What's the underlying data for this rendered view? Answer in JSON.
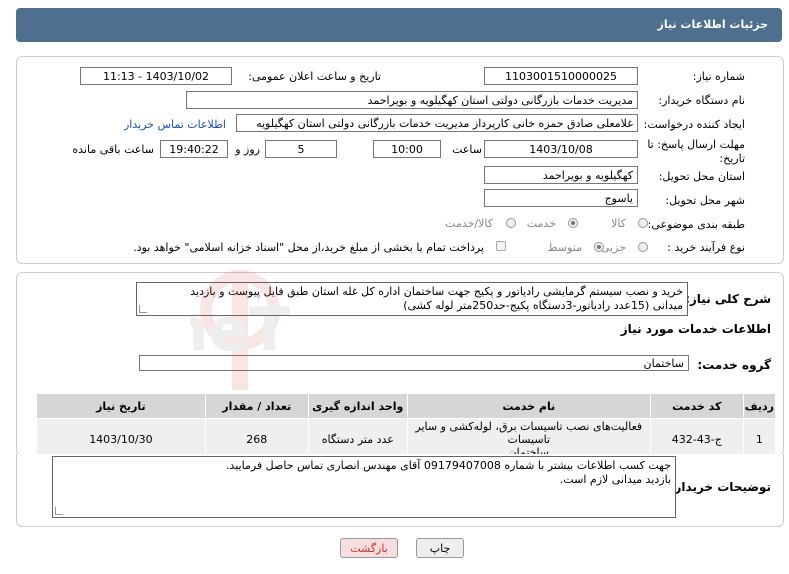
{
  "header": {
    "title": "جزئیات اطلاعات نیاز"
  },
  "form": {
    "need_number_label": "شماره نیاز:",
    "need_number": "1103001510000025",
    "announce_label": "تاریخ و ساعت اعلان عمومی:",
    "announce_value": "1403/10/02 - 11:13",
    "buyer_org_label": "نام دستگاه خریدار:",
    "buyer_org": "مدیریت خدمات بازرگانی دولتی استان کهگیلویه و بویراحمد",
    "creator_label": "ایجاد کننده درخواست:",
    "creator": "غلامعلی صادق حمزه خانی کارپرداز مدیریت خدمات بازرگانی دولتی استان کهگیلویه",
    "contact_link": "اطلاعات تماس خریدار",
    "deadline_label_1": "مهلت ارسال پاسخ: تا",
    "deadline_label_2": "تاریخ:",
    "deadline_date": "1403/10/08",
    "time_label": "ساعت",
    "deadline_time": "10:00",
    "days_value": "5",
    "days_label": "روز و",
    "remaining_time": "19:40:22",
    "remaining_label": "ساعت باقی مانده",
    "province_label": "استان محل تحویل:",
    "province": "کهگیلویه و بویراحمد",
    "city_label": "شهر محل تحویل:",
    "city": "یاسوج",
    "category_label": "طبقه بندی موضوعی:",
    "category_options": [
      "کالا",
      "خدمت",
      "کالا/خدمت"
    ],
    "process_label": "نوع فرآیند خرید :",
    "process_options": [
      "جزیی",
      "متوسط"
    ],
    "payment_note": "پرداخت تمام یا بخشی از مبلغ خرید،از محل \"اسناد خزانه اسلامی\" خواهد بود."
  },
  "description": {
    "label": "شرح کلی نیاز:",
    "lines": [
      "خرید و نصب سیستم گرمایشی رادیاتور و پکیج جهت ساختمان اداره کل غله استان طبق فایل پیوست و بازدید",
      "میدانی (15عدد رادیاتور-3دستگاه پکیج-حد250متر لوله کشی)"
    ]
  },
  "services": {
    "section_title": "اطلاعات خدمات مورد نیاز",
    "group_label": "گروه خدمت:",
    "group_value": "ساختمان",
    "columns": [
      "ردیف",
      "کد خدمت",
      "نام خدمت",
      "واحد اندازه گیری",
      "تعداد / مقدار",
      "تاریخ نیاز"
    ],
    "rows": [
      {
        "index": "1",
        "code": "ج-43-432",
        "name_line1": "فعالیت‌های نصب تاسیسات برق، لوله‌کشی و سایر تاسیسات",
        "name_line2": "ساختمان",
        "unit": "عدد متر دستگاه",
        "quantity": "268",
        "date": "1403/10/30"
      }
    ]
  },
  "buyer_notes": {
    "label": "توضیحات خریدار:",
    "lines": [
      "جهت کسب اطلاعات بیشتر با شماره 09179407008 آقای مهندس انصاری تماس حاصل فرمایید.",
      "بازدید میدانی لازم است."
    ]
  },
  "buttons": {
    "print": "چاپ",
    "back": "بازگشت"
  },
  "watermark": {
    "text": "AriaTender.neT"
  },
  "colors": {
    "header_bg": "#4f6f8f",
    "link": "#1e4fb4",
    "back_btn_text": "#c0392b"
  }
}
